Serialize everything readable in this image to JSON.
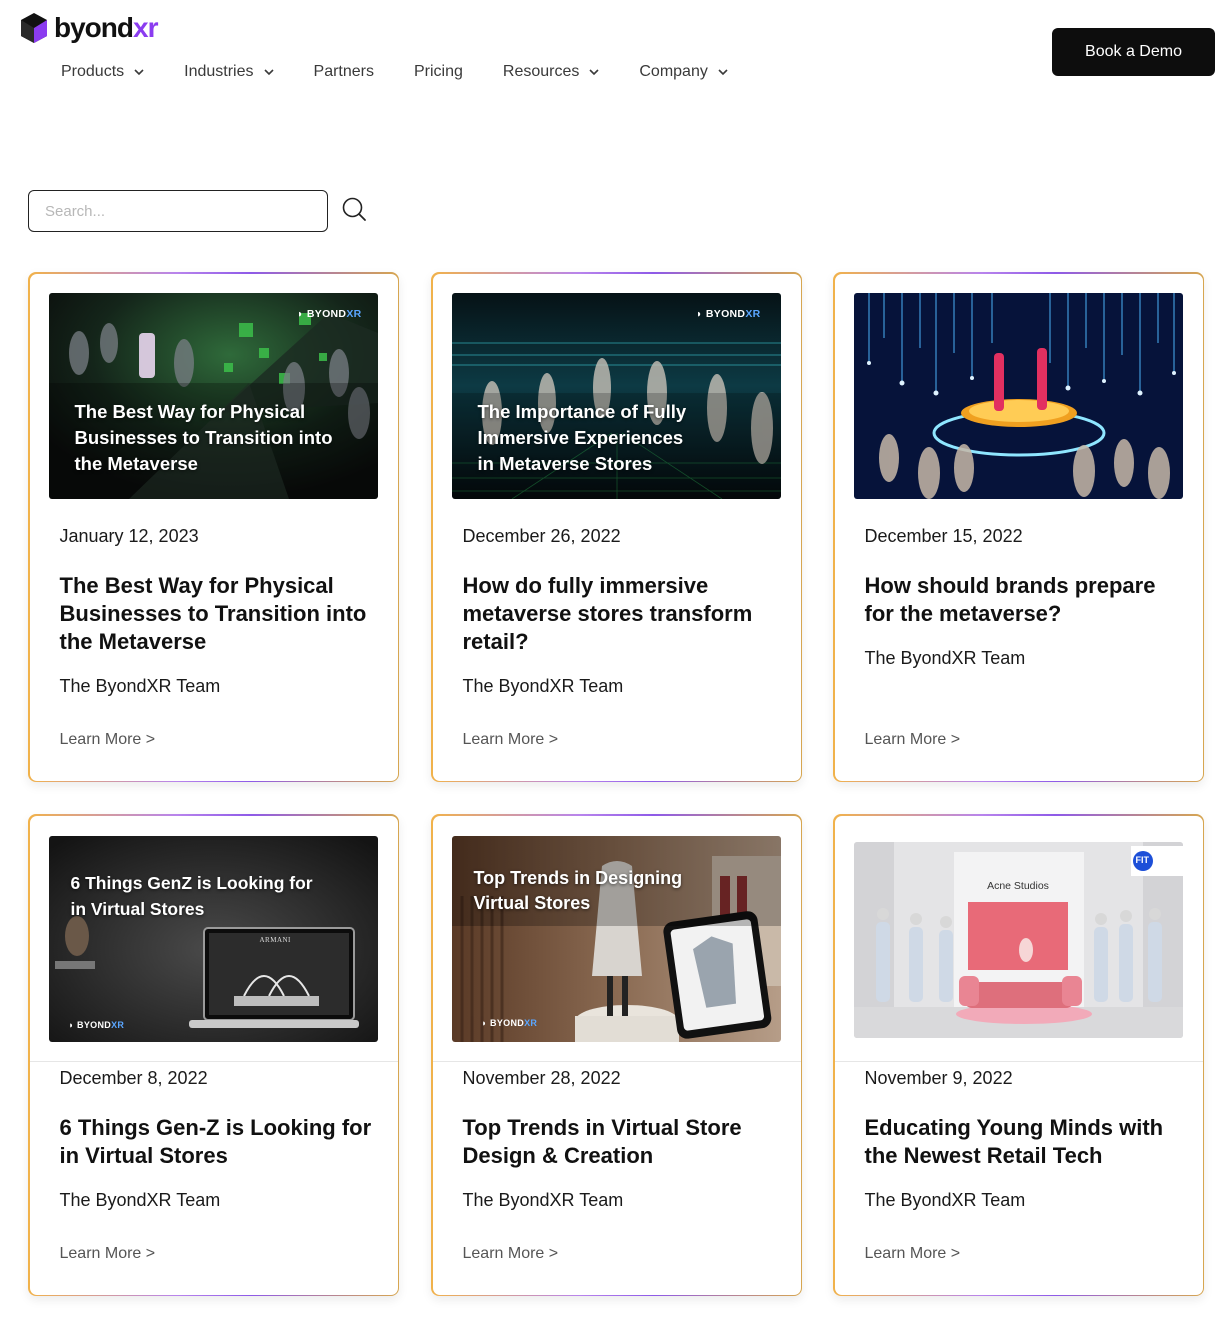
{
  "brand": {
    "name_part1": "byond",
    "name_part2": "xr",
    "accent": "#8b3cf0"
  },
  "nav": [
    {
      "label": "Products",
      "has_dropdown": true
    },
    {
      "label": "Industries",
      "has_dropdown": true
    },
    {
      "label": "Partners",
      "has_dropdown": false
    },
    {
      "label": "Pricing",
      "has_dropdown": false
    },
    {
      "label": "Resources",
      "has_dropdown": true
    },
    {
      "label": "Company",
      "has_dropdown": true
    }
  ],
  "cta": {
    "label": "Book a Demo"
  },
  "search": {
    "placeholder": "Search..."
  },
  "posts": [
    {
      "thumb_title": [
        "The Best Way for Physical",
        "Businesses to Transition into",
        "the Metaverse"
      ],
      "thumb_brand": "BYOND",
      "thumb_brand_xr": "XR",
      "date": "January 12, 2023",
      "title": "The Best Way for Physical Businesses to Transition into the Metaverse",
      "author": "The ByondXR Team",
      "link": "Learn More >"
    },
    {
      "thumb_title": [
        "The Importance of Fully",
        "Immersive Experiences",
        "in Metaverse Stores"
      ],
      "thumb_brand": "BYOND",
      "thumb_brand_xr": "XR",
      "date": "December 26, 2022",
      "title": "How do fully immersive metaverse stores transform retail?",
      "author": "The ByondXR Team",
      "link": "Learn More >"
    },
    {
      "date": "December 15, 2022",
      "title": "How should brands prepare for the metaverse?",
      "author": "The ByondXR Team",
      "link": "Learn More >"
    },
    {
      "thumb_title": [
        "6 Things GenZ is Looking for",
        "in Virtual Stores"
      ],
      "thumb_brand": "BYOND",
      "thumb_brand_xr": "XR",
      "thumb_screen_brand": "ARMANI",
      "date": "December 8, 2022",
      "title": "6 Things Gen-Z is Looking for in Virtual Stores",
      "author": "The ByondXR Team",
      "link": "Learn More >"
    },
    {
      "thumb_title": [
        "Top Trends in Designing",
        "Virtual Stores"
      ],
      "thumb_brand": "BYOND",
      "thumb_brand_xr": "XR",
      "date": "November 28, 2022",
      "title": "Top Trends in Virtual Store Design & Creation",
      "author": "The ByondXR Team",
      "link": "Learn More >"
    },
    {
      "thumb_store": "Acne Studios",
      "thumb_badge": "FIT",
      "date": "November 9, 2022",
      "title": "Educating Young Minds with the Newest Retail Tech",
      "author": "The ByondXR Team",
      "link": "Learn More >"
    }
  ]
}
